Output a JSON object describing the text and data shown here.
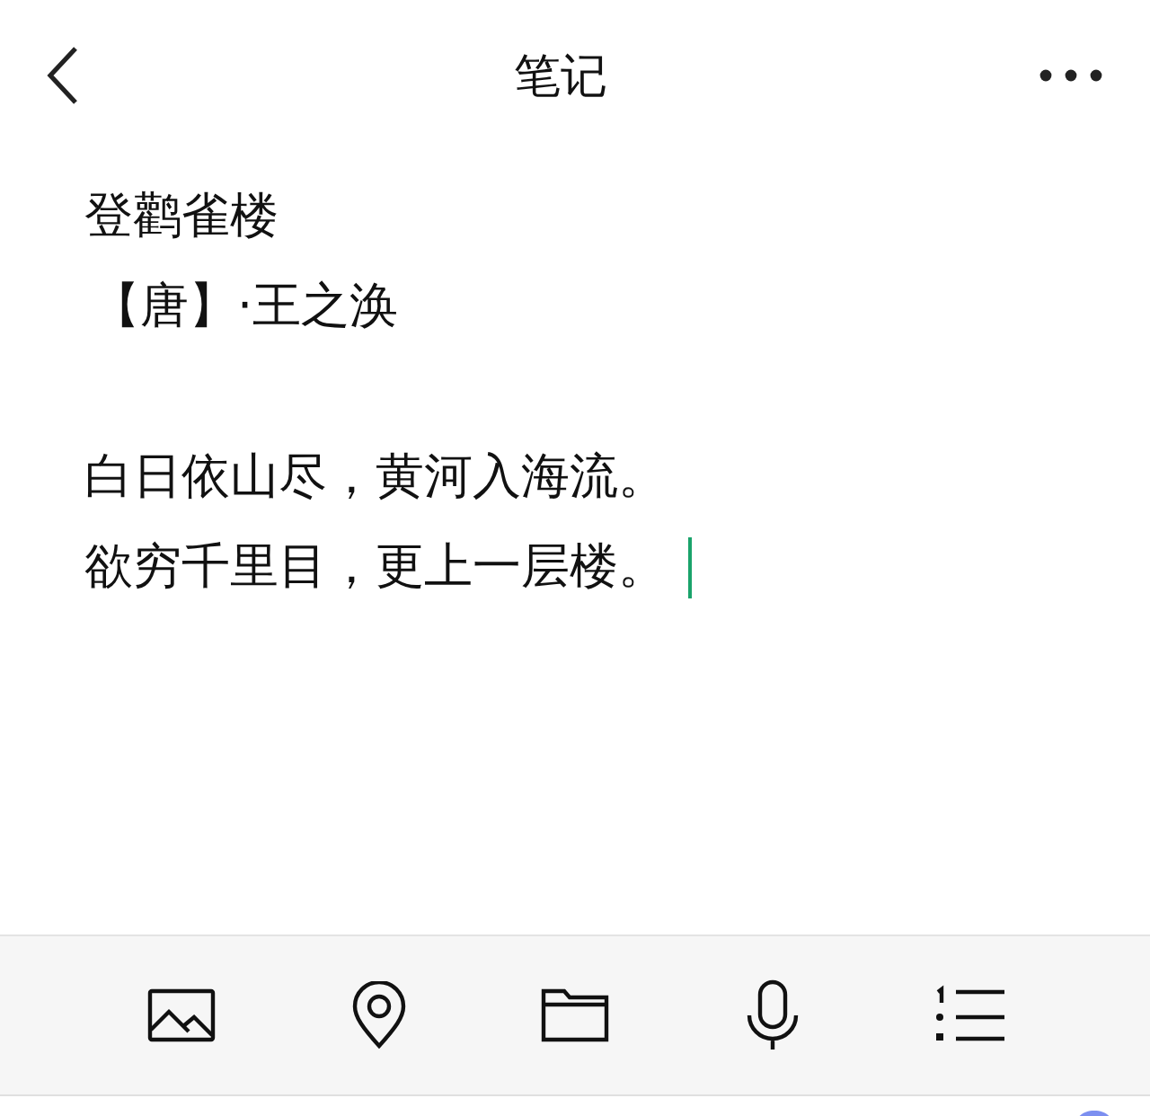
{
  "header": {
    "title": "笔记"
  },
  "note": {
    "title": "登鹳雀楼",
    "author": "【唐】·王之涣",
    "verses": [
      "白日依山尽，黄河入海流。",
      "欲穷千里目，更上一层楼。"
    ],
    "cursor_visible": true
  }
}
